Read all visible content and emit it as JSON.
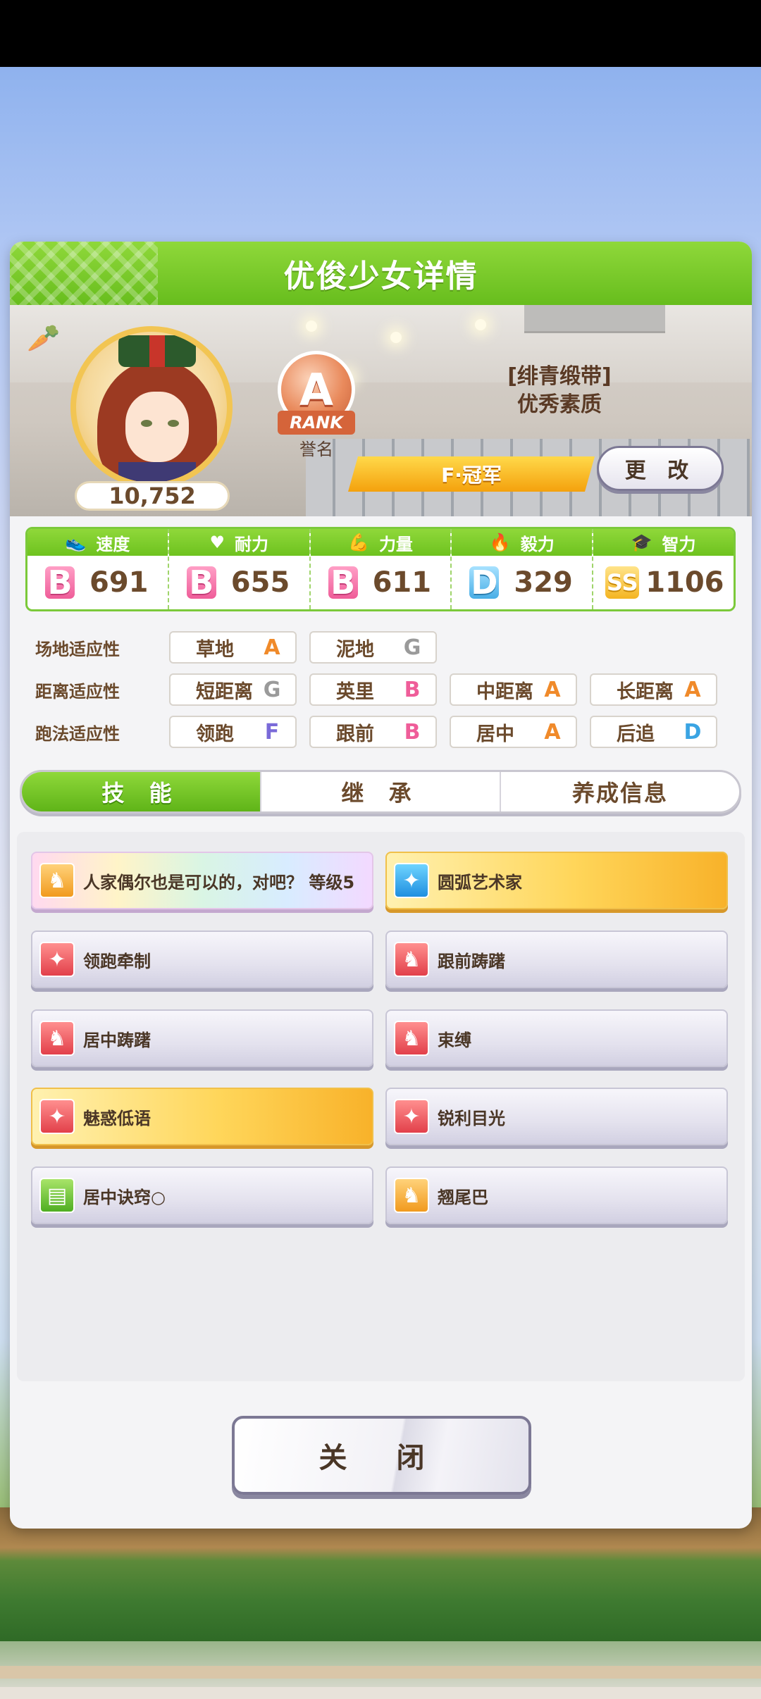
{
  "header": {
    "title": "优俊少女详情"
  },
  "profile": {
    "fans": "10,752",
    "rank_letter": "A",
    "rank_label": "RANK",
    "honor_label": "誉名",
    "title_line1": "[绯青缎带]",
    "title_line2": "优秀素质",
    "champion_banner": "F·冠军",
    "change_button": "更 改"
  },
  "stats": [
    {
      "label": "速度",
      "icon": "shoe-icon",
      "grade": "B",
      "value": "691"
    },
    {
      "label": "耐力",
      "icon": "heart-icon",
      "grade": "B",
      "value": "655"
    },
    {
      "label": "力量",
      "icon": "muscle-icon",
      "grade": "B",
      "value": "611"
    },
    {
      "label": "毅力",
      "icon": "flame-icon",
      "grade": "D",
      "value": "329"
    },
    {
      "label": "智力",
      "icon": "graduation-cap-icon",
      "grade": "SS",
      "value": "1106"
    }
  ],
  "aptitude": {
    "field": {
      "label": "场地适应性",
      "items": [
        {
          "name": "草地",
          "grade": "A"
        },
        {
          "name": "泥地",
          "grade": "G"
        }
      ]
    },
    "distance": {
      "label": "距离适应性",
      "items": [
        {
          "name": "短距离",
          "grade": "G"
        },
        {
          "name": "英里",
          "grade": "B"
        },
        {
          "name": "中距离",
          "grade": "A"
        },
        {
          "name": "长距离",
          "grade": "A"
        }
      ]
    },
    "style": {
      "label": "跑法适应性",
      "items": [
        {
          "name": "领跑",
          "grade": "F"
        },
        {
          "name": "跟前",
          "grade": "B"
        },
        {
          "name": "居中",
          "grade": "A"
        },
        {
          "name": "后追",
          "grade": "D"
        }
      ]
    }
  },
  "tabs": [
    "技 能",
    "继 承",
    "养成信息"
  ],
  "skills": [
    {
      "name": "人家偶尔也是可以的，对吧？ 等级5",
      "icon": "horse-silhouette-icon",
      "style": "rainbow"
    },
    {
      "name": "圆弧艺术家",
      "icon": "sparkle-icon",
      "style": "gold"
    },
    {
      "name": "领跑牵制",
      "icon": "sparkle-icon",
      "style": "normal"
    },
    {
      "name": "跟前踌躇",
      "icon": "horse-silhouette-icon",
      "style": "normal"
    },
    {
      "name": "居中踌躇",
      "icon": "horse-silhouette-icon",
      "style": "normal"
    },
    {
      "name": "束缚",
      "icon": "horse-silhouette-icon",
      "style": "normal"
    },
    {
      "name": "魅惑低语",
      "icon": "sparkle-icon",
      "style": "gold"
    },
    {
      "name": "锐利目光",
      "icon": "sparkle-icon",
      "style": "normal"
    },
    {
      "name": "居中诀窍○",
      "icon": "book-icon",
      "style": "normal"
    },
    {
      "name": "翘尾巴",
      "icon": "horse-silhouette-icon",
      "style": "normal"
    }
  ],
  "close_button": "关 闭"
}
